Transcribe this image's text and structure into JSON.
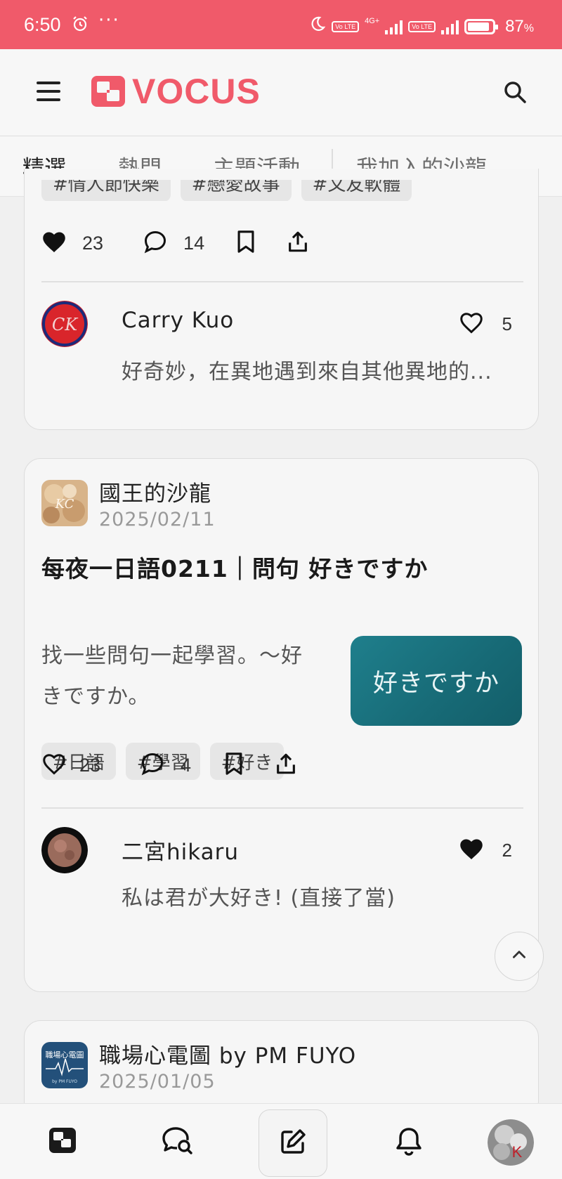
{
  "status_bar": {
    "time": "6:50",
    "more": "···",
    "battery_percent": "87",
    "battery_symbol": "%",
    "battery_level": 0.87,
    "volte_label": "Vo LTE",
    "network_label": "4G+"
  },
  "header": {
    "logo_text": "VOCUS",
    "brand_color": "#f05a6a"
  },
  "tabs": [
    {
      "label": "精選",
      "active": true
    },
    {
      "label": "熱門",
      "active": false
    },
    {
      "label": "主題活動",
      "active": false
    },
    {
      "label": "我加入的沙龍",
      "active": false
    }
  ],
  "feed": {
    "card1": {
      "tags": [
        "#情人節快樂",
        "#戀愛故事",
        "#文友軟體"
      ],
      "likes": "23",
      "comments": "14",
      "liked": true,
      "top_comment": {
        "author": "Carry Kuo",
        "avatar_letters": "CK",
        "text": "好奇妙，在異地遇到來自其他異地的...",
        "likes": "5",
        "liked": false
      }
    },
    "card2": {
      "publisher": "國王的沙龍",
      "publisher_badge": "KC",
      "date": "2025/02/11",
      "title": "每夜一日語0211｜問句 好きですか",
      "excerpt": "找一些問句一起學習。～好きですか。",
      "cover_text": "好きですか",
      "tags": [
        "#日語",
        "#學習",
        "#好き"
      ],
      "likes": "23",
      "comments": "4",
      "liked": false,
      "top_comment": {
        "author": "二宮hikaru",
        "text": "私は君が大好き! (直接了當)",
        "likes": "2",
        "liked": true
      }
    },
    "card3": {
      "publisher": "職場心電圖 by PM FUYO",
      "publisher_badge": "職場心電圖",
      "publisher_badge_sub": "by PM FUYO",
      "date": "2025/01/05"
    }
  },
  "bottom_nav": {
    "items": [
      "home-icon",
      "discover-icon",
      "compose-icon",
      "bell-icon",
      "profile-avatar"
    ],
    "profile_letter": "K"
  }
}
